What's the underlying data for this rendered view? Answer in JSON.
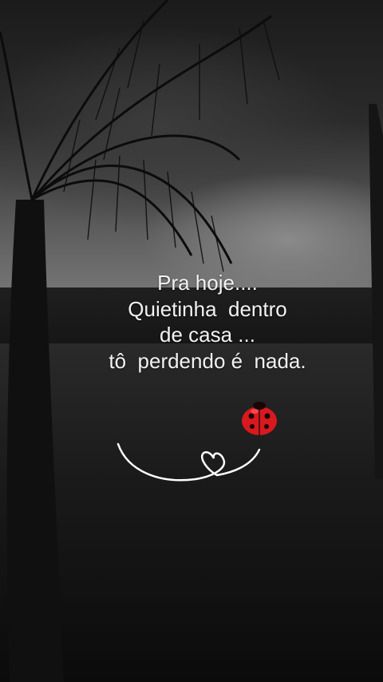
{
  "message": {
    "line1": "Pra hoje....",
    "line2": "Quietinha  dentro",
    "line3": "de casa ...",
    "line4": "tô  perdendo é  nada."
  },
  "decorations": {
    "ladybug_icon": "ladybug-icon",
    "heart_flourish": "heart-swirl-icon",
    "palm_tree": "palm-tree-silhouette"
  },
  "colors": {
    "text": "#f2f2f2",
    "ladybug": "#d8191f",
    "flourish": "#ffffff"
  }
}
